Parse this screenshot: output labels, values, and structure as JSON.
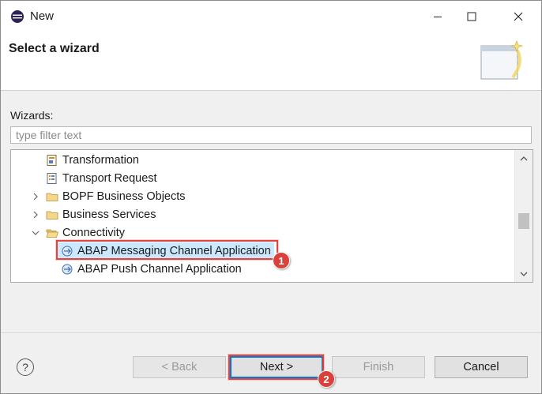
{
  "window": {
    "title": "New",
    "controls": {
      "minimize": "minimize",
      "maximize": "maximize",
      "close": "close"
    }
  },
  "header": {
    "title": "Select a wizard"
  },
  "wizards": {
    "label": "Wizards:",
    "filter_placeholder": "type filter text",
    "filter_value": ""
  },
  "tree": {
    "items": [
      {
        "label": "Transformation",
        "icon": "transformation-icon",
        "expandable": false
      },
      {
        "label": "Transport Request",
        "icon": "transport-request-icon",
        "expandable": false
      },
      {
        "label": "BOPF Business Objects",
        "icon": "folder-icon",
        "expandable": true,
        "expanded": false
      },
      {
        "label": "Business Services",
        "icon": "folder-icon",
        "expandable": true,
        "expanded": false
      },
      {
        "label": "Connectivity",
        "icon": "folder-open-icon",
        "expandable": true,
        "expanded": true
      },
      {
        "label": "ABAP Messaging Channel Application",
        "icon": "channel-icon",
        "expandable": false,
        "selected": true
      },
      {
        "label": "ABAP Push Channel Application",
        "icon": "channel-icon",
        "expandable": false
      }
    ]
  },
  "callouts": {
    "step1": "1",
    "step2": "2"
  },
  "buttons": {
    "help": "?",
    "back": "< Back",
    "next": "Next >",
    "finish": "Finish",
    "cancel": "Cancel"
  },
  "colors": {
    "callout": "#d9413a",
    "accent": "#0078d7"
  }
}
